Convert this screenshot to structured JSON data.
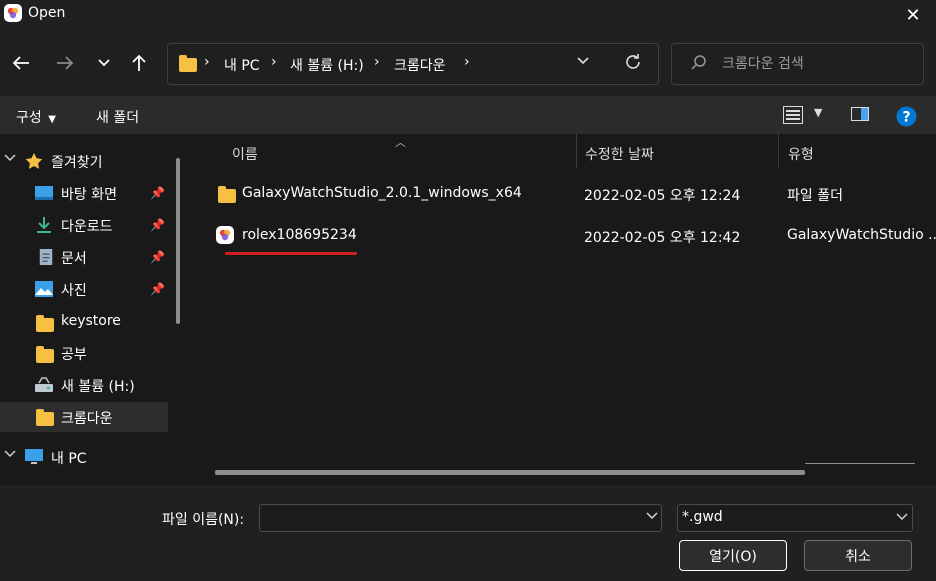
{
  "window": {
    "title": "Open",
    "close_label": "✕"
  },
  "nav": {
    "back_icon": "arrow-left-icon",
    "forward_icon": "arrow-right-icon",
    "recent_icon": "chevron-down-icon",
    "up_icon": "arrow-up-icon"
  },
  "address": {
    "crumbs": [
      "내 PC",
      "새 볼륨 (H:)",
      "크롬다운"
    ],
    "separator": "›"
  },
  "search": {
    "placeholder": "크롬다운 검색"
  },
  "toolbar": {
    "organize_label": "구성",
    "new_folder_label": "새 폴더"
  },
  "sidebar": {
    "items": [
      {
        "label": "즐겨찾기",
        "icon": "star-icon",
        "pinned": false
      },
      {
        "label": "바탕 화면",
        "icon": "desktop-icon",
        "pinned": true
      },
      {
        "label": "다운로드",
        "icon": "download-icon",
        "pinned": true
      },
      {
        "label": "문서",
        "icon": "document-icon",
        "pinned": true
      },
      {
        "label": "사진",
        "icon": "picture-icon",
        "pinned": true
      },
      {
        "label": "keystore",
        "icon": "folder-icon",
        "pinned": false
      },
      {
        "label": "공부",
        "icon": "folder-icon",
        "pinned": false
      },
      {
        "label": "새 볼륨 (H:)",
        "icon": "drive-icon",
        "pinned": false
      },
      {
        "label": "크롬다운",
        "icon": "folder-icon",
        "pinned": false,
        "selected": true
      },
      {
        "label": "내 PC",
        "icon": "pc-icon",
        "pinned": false
      }
    ]
  },
  "columns": {
    "name": "이름",
    "modified": "수정한 날짜",
    "type": "유형"
  },
  "files": [
    {
      "name": "GalaxyWatchStudio_2.0.1_windows_x64",
      "modified": "2022-02-05 오후 12:24",
      "type": "파일 폴더",
      "icon": "folder-icon"
    },
    {
      "name": "rolex108695234",
      "modified": "2022-02-05 오후 12:42",
      "type": "GalaxyWatchStudio ...",
      "icon": "galaxy-watch-studio-icon"
    }
  ],
  "footer": {
    "filename_label": "파일 이름(N):",
    "filename_value": "",
    "filetype_value": "*.gwd",
    "open_label": "열기(O)",
    "cancel_label": "취소"
  },
  "colors": {
    "folder": "#f8c042",
    "accent": "#0078d4",
    "annotation": "#d01f1f"
  }
}
